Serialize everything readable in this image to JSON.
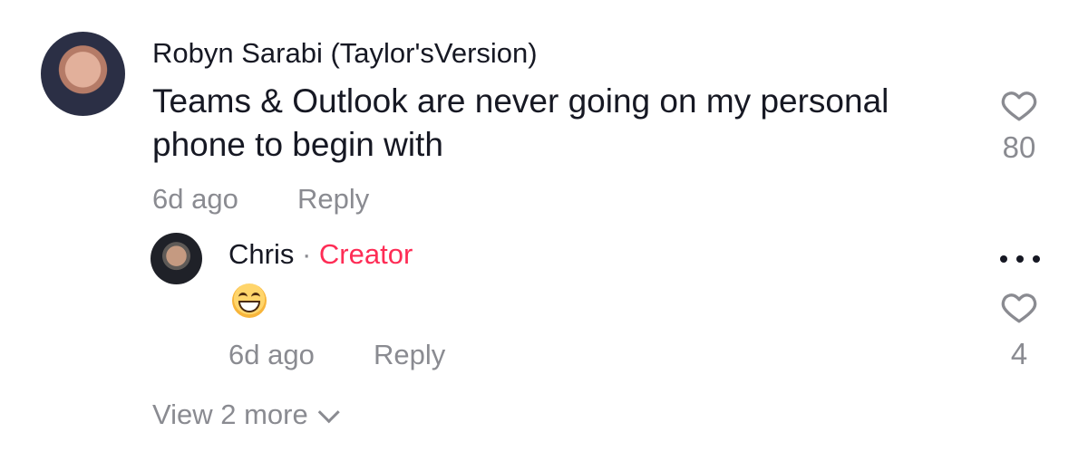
{
  "comment": {
    "author": "Robyn Sarabi (Taylor'sVersion)",
    "content": "Teams & Outlook are never going on my personal phone to begin with",
    "time": "6d ago",
    "reply_label": "Reply",
    "likes": "80"
  },
  "reply": {
    "author": "Chris",
    "separator": "·",
    "badge": "Creator",
    "time": "6d ago",
    "reply_label": "Reply",
    "likes": "4",
    "emoji_icon": "grinning-face-icon"
  },
  "thread": {
    "view_more": "View 2 more"
  },
  "icons": {
    "heart": "heart-outline-icon",
    "more": "more-options-icon",
    "chevron": "chevron-down-icon"
  },
  "colors": {
    "creator": "#fe2c55",
    "muted": "#8a8b91",
    "text": "#161823"
  }
}
